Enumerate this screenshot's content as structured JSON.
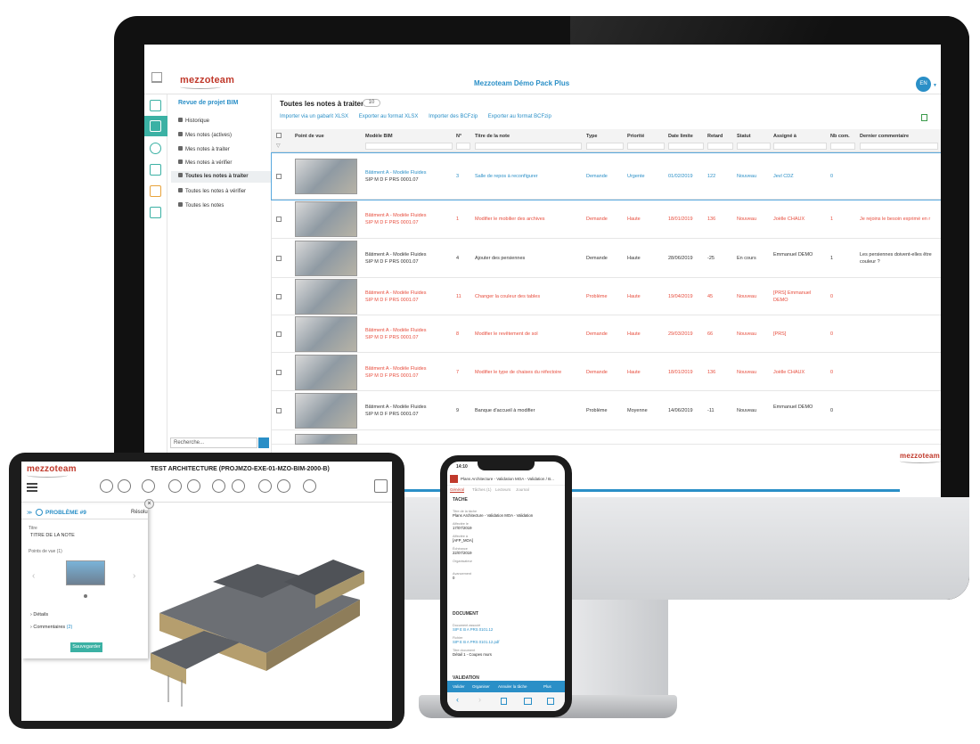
{
  "desktop": {
    "logo": "mezzoteam",
    "app_title": "Mezzoteam Démo Pack Plus",
    "lang": "EN",
    "sidebar": {
      "title": "Revue de projet BIM",
      "items": [
        "Historique",
        "Mes notes (actives)",
        "Mes notes à traiter",
        "Mes notes à vérifier",
        "Toutes les notes à traiter",
        "Toutes les notes à vérifier",
        "Toutes les notes"
      ],
      "search_placeholder": "Recherche..."
    },
    "main": {
      "title": "Toutes les notes à traiter",
      "count": "10",
      "actions": [
        "Importer via un gabarit XLSX",
        "Exporter au format XLSX",
        "Importer des BCFzip",
        "Exporter au format BCFzip"
      ]
    },
    "table": {
      "headers": [
        "Point de vue",
        "Modèle BIM",
        "N°",
        "Titre de la note",
        "Type",
        "Priorité",
        "Date limite",
        "Retard",
        "Statut",
        "Assigné à",
        "Nb com.",
        "Dernier commentaire"
      ],
      "rows": [
        {
          "model": "Bâtiment A - Modèle Fluides",
          "ref": "SIP M D F PRS 0001.07",
          "num": "3",
          "title": "Salle de repos à reconfigurer",
          "type": "Demande",
          "priority": "Urgente",
          "date": "01/02/2019",
          "delay": "122",
          "status": "Nouveau",
          "assignee": "Jevl CDZ",
          "nb": "0",
          "comment": "",
          "color": "blue"
        },
        {
          "model": "Bâtiment A - Modèle Fluides",
          "ref": "SIP M D F PRS 0001.07",
          "num": "1",
          "title": "Modifier le mobilier des archives",
          "type": "Demande",
          "priority": "Haute",
          "date": "18/01/2019",
          "delay": "136",
          "status": "Nouveau",
          "assignee": "Joëlle CHAUX",
          "nb": "1",
          "comment": "Je rejoins le besoin exprimé en r",
          "color": "red"
        },
        {
          "model": "Bâtiment A - Modèle Fluides",
          "ref": "SIP M D F PRS 0001.07",
          "num": "4",
          "title": "Ajouter des persiennes",
          "type": "Demande",
          "priority": "Haute",
          "date": "28/06/2019",
          "delay": "-25",
          "status": "En cours",
          "assignee": "Emmanuel DEMO",
          "nb": "1",
          "comment": "Les persiennes doivent-elles être couleur ?",
          "color": "dark"
        },
        {
          "model": "Bâtiment A - Modèle Fluides",
          "ref": "SIP M D F PRS 0001.07",
          "num": "11",
          "title": "Changer la couleur des tables",
          "type": "Problème",
          "priority": "Haute",
          "date": "19/04/2019",
          "delay": "45",
          "status": "Nouveau",
          "assignee": "[PRS] Emmanuel DEMO",
          "nb": "0",
          "comment": "",
          "color": "red"
        },
        {
          "model": "Bâtiment A - Modèle Fluides",
          "ref": "SIP M D F PRS 0001.07",
          "num": "8",
          "title": "Modifier le revêtement de sol",
          "type": "Demande",
          "priority": "Haute",
          "date": "29/03/2019",
          "delay": "66",
          "status": "Nouveau",
          "assignee": "[PRS]",
          "nb": "0",
          "comment": "",
          "color": "red"
        },
        {
          "model": "Bâtiment A - Modèle Fluides",
          "ref": "SIP M D F PRS 0001.07",
          "num": "7",
          "title": "Modifier le type de chaises du réfectoire",
          "type": "Demande",
          "priority": "Haute",
          "date": "18/01/2019",
          "delay": "136",
          "status": "Nouveau",
          "assignee": "Joëlle CHAUX",
          "nb": "0",
          "comment": "",
          "color": "red"
        },
        {
          "model": "Bâtiment A - Modèle Fluides",
          "ref": "SIP M D F PRS 0001.07",
          "num": "9",
          "title": "Banque d'accueil à modifier",
          "type": "Problème",
          "priority": "Moyenne",
          "date": "14/06/2019",
          "delay": "-11",
          "status": "Nouveau",
          "assignee": "Emmanuel DEMO",
          "nb": "0",
          "comment": "",
          "color": "dark"
        }
      ]
    }
  },
  "tablet": {
    "logo": "mezzoteam",
    "title": "TEST ARCHITECTURE (PROJMZO-EXE-01-MZO-BIM-2000-B)",
    "issue_label": "PROBLÈME #9",
    "resolve": "Résolu",
    "field_title_label": "Titre",
    "field_title_value": "TITRE DE LA NOTE",
    "viewpoint_label": "Points de vue (1)",
    "details": "Détails",
    "comments": "Commentaires",
    "comments_count": "(2)",
    "save": "Sauvegarder"
  },
  "phone": {
    "time": "14:10",
    "header": "Plans Architecture - Validation MOA - Validation / B...",
    "tabs": [
      "Général",
      "Tâches (1)",
      "Lecteurs",
      "Journal"
    ],
    "section_task": "TACHE",
    "fields": [
      {
        "label": "Titre de la tâche",
        "value": "Plans Architecture - Validation MOA - Validation"
      },
      {
        "label": "Affectée le",
        "value": "17/07/2019"
      },
      {
        "label": "Affectée à",
        "value": "[AFP_MOA]"
      },
      {
        "label": "Échéance",
        "value": "22/07/2019"
      },
      {
        "label": "Organisateur",
        "value": ""
      },
      {
        "label": "Avancement",
        "value": "0"
      }
    ],
    "section_doc": "DOCUMENT",
    "doc_fields": [
      {
        "label": "Document associé",
        "value": "SIP E B A PRS 0101.12"
      },
      {
        "label": "Fichier",
        "value": "SIP E B A PRS 0101.12.pdf"
      },
      {
        "label": "Titre document",
        "value": "Détail 1 - Coupes murs"
      }
    ],
    "section_validation": "VALIDATION",
    "buttons": [
      "Valider",
      "Organiser",
      "Annuler la tâche",
      "Plus"
    ]
  }
}
